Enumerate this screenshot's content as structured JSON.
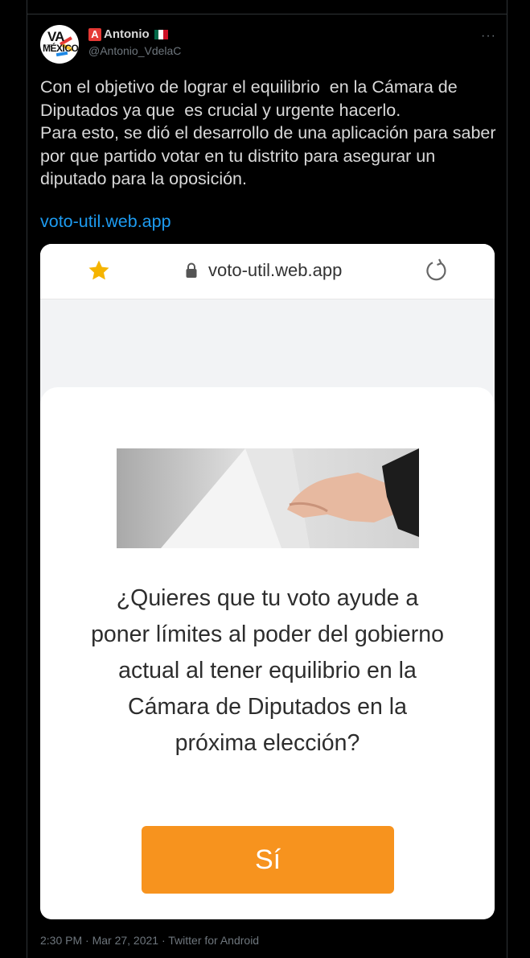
{
  "tweet": {
    "author": {
      "badge_letter": "A",
      "display_name": "Antonio",
      "handle": "@Antonio_VdelaC",
      "avatar_text_top": "VA",
      "avatar_text_por": "POR",
      "avatar_text_bottom": "MÉXICO"
    },
    "more_label": "···",
    "text": "Con el objetivo de lograr el equilibrio  en la Cámara de Diputados ya que  es crucial y urgente hacerlo.\nPara esto, se dió el desarrollo de una aplicación para saber por que partido votar en tu distrito para asegurar un diputado para la oposición.",
    "link": "voto-util.web.app",
    "meta": "2:30 PM · Mar 27, 2021 · Twitter for Android"
  },
  "screenshot": {
    "url": "voto-util.web.app",
    "question": "¿Quieres que tu voto ayude a poner límites al poder del gobierno actual al tener equilibrio en la Cámara de Diputados en la próxima elección?",
    "button_label": "Sí"
  },
  "icons": {
    "star": "star-icon",
    "lock": "lock-icon",
    "reload": "reload-icon",
    "flag": "mexico-flag-icon"
  },
  "colors": {
    "link": "#1d9bf0",
    "button": "#f7931e",
    "star": "#f5b400",
    "badge": "#e53935"
  }
}
